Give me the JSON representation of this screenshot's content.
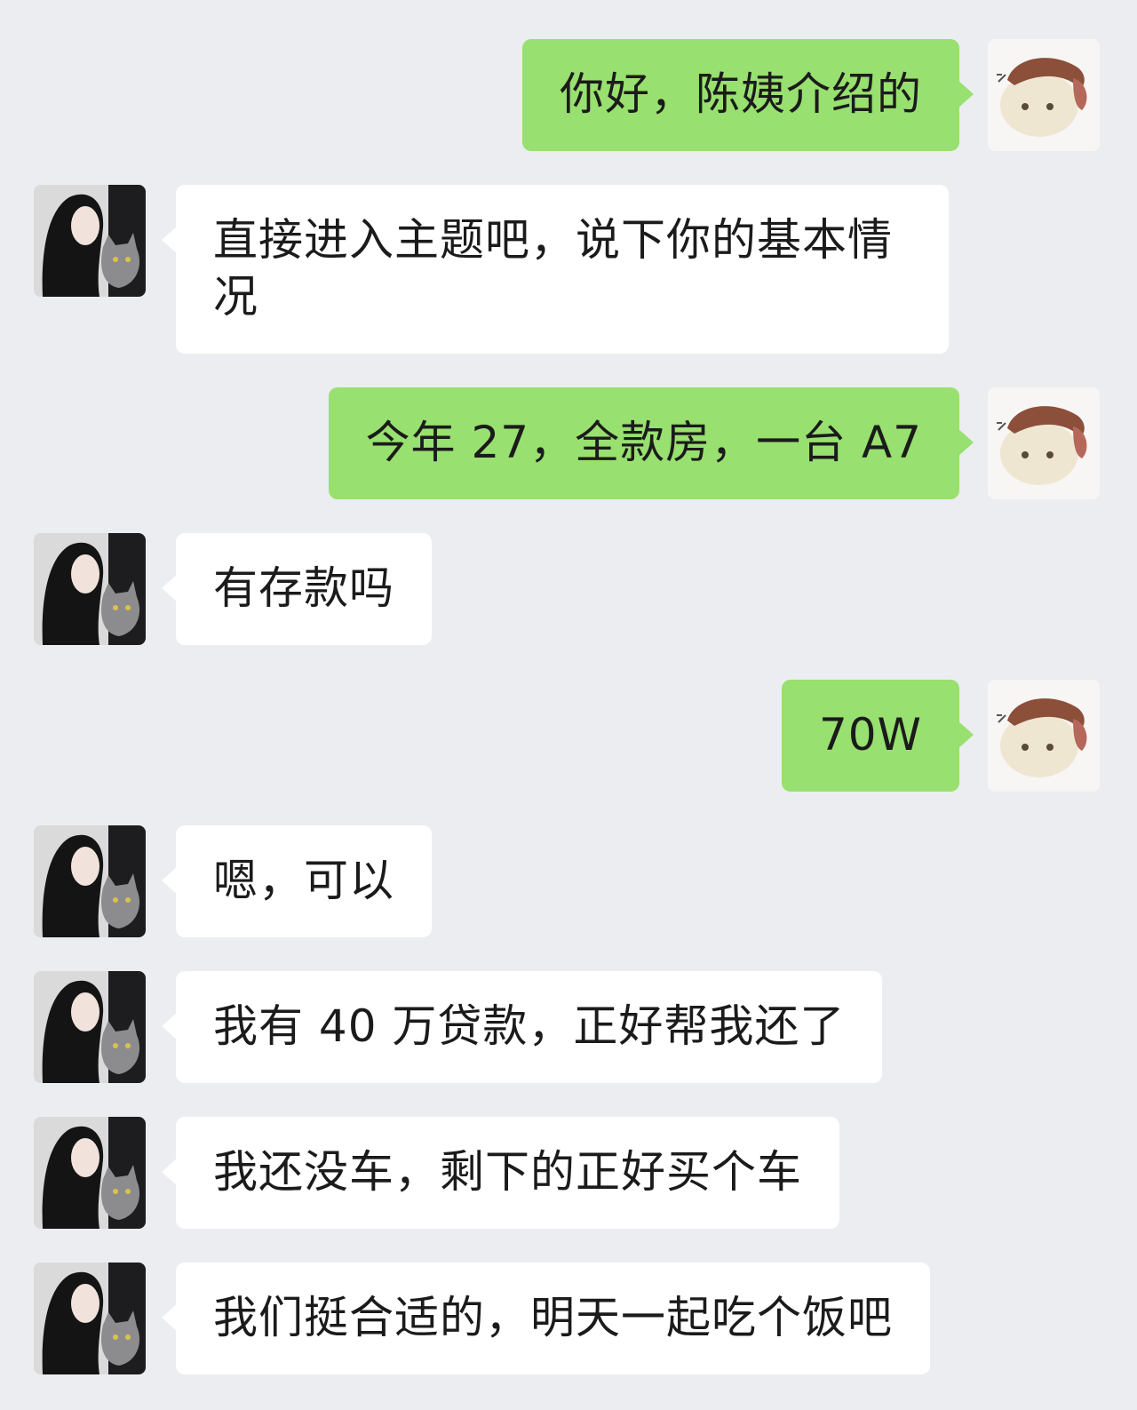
{
  "chat": {
    "messages": [
      {
        "from": "me",
        "text": "你好，陈姨介绍的"
      },
      {
        "from": "them",
        "text": "直接进入主题吧，说下你的基本情况"
      },
      {
        "from": "me",
        "text": "今年 27，全款房，一台 A7"
      },
      {
        "from": "them",
        "text": "有存款吗"
      },
      {
        "from": "me",
        "text": "70W"
      },
      {
        "from": "them",
        "text": "嗯，可以"
      },
      {
        "from": "them",
        "text": "我有 40 万贷款，正好帮我还了"
      },
      {
        "from": "them",
        "text": "我还没车，剩下的正好买个车"
      },
      {
        "from": "them",
        "text": "我们挺合适的，明天一起吃个饭吧"
      }
    ]
  },
  "colors": {
    "background": "#ecedf0",
    "sent_bubble": "#98e06f",
    "received_bubble": "#ffffff"
  },
  "icons": {
    "my_avatar": "cartoon-face-avatar",
    "their_avatar": "girl-with-cat-avatar"
  }
}
